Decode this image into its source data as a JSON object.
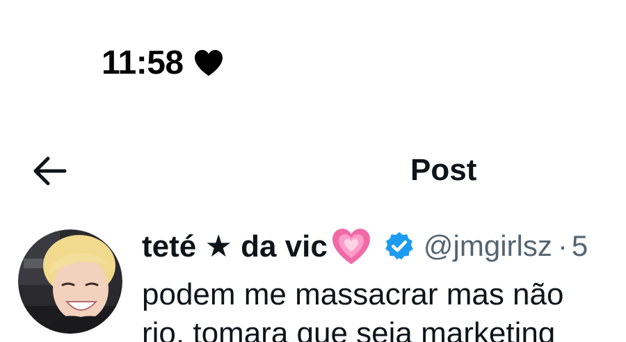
{
  "status_bar": {
    "time": "11:58",
    "status_icon": "heart-icon"
  },
  "header": {
    "back_icon": "arrow-left-icon",
    "title": "Post"
  },
  "post": {
    "author": {
      "display_name": "teté ★ da vic",
      "name_emoji": "pink-heart-icon",
      "verified": true,
      "handle": "@jmgirlsz",
      "separator": "·",
      "time_partial": "5"
    },
    "text_lines": [
      "podem me massacrar mas não",
      "rio, tomara que seja marketing"
    ]
  },
  "colors": {
    "text_primary": "#0f1419",
    "text_secondary": "#536471",
    "verified_blue": "#1d9bf0",
    "emoji_pink": "#f06aa8",
    "background": "#ffffff"
  }
}
